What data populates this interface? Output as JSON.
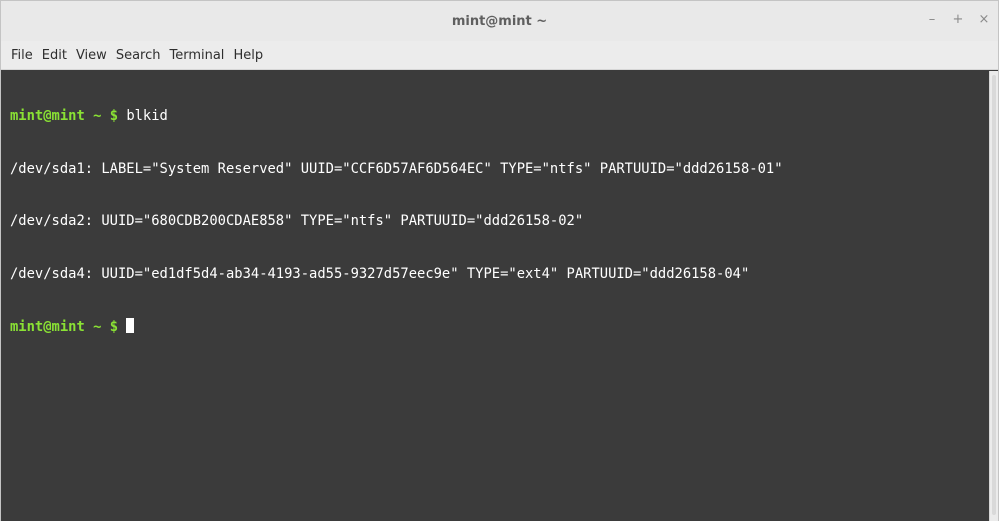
{
  "window": {
    "title": "mint@mint ~",
    "controls": [
      "–",
      "+",
      "×"
    ]
  },
  "menu": [
    "File",
    "Edit",
    "View",
    "Search",
    "Terminal",
    "Help"
  ],
  "terminal": {
    "prompt_user": "mint@mint",
    "prompt_dir": " ~ ",
    "prompt_symbol": "$ ",
    "command": "blkid",
    "output": [
      "/dev/sda1: LABEL=\"System Reserved\" UUID=\"CCF6D57AF6D564EC\" TYPE=\"ntfs\" PARTUUID=\"ddd26158-01\"",
      "/dev/sda2: UUID=\"680CDB200CDAE858\" TYPE=\"ntfs\" PARTUUID=\"ddd26158-02\"",
      "/dev/sda4: UUID=\"ed1df5d4-ab34-4193-ad55-9327d57eec9e\" TYPE=\"ext4\" PARTUUID=\"ddd26158-04\""
    ]
  },
  "colors": {
    "terminal_bg": "#3b3b3b",
    "prompt": "#8ae234",
    "text": "#ffffff"
  }
}
